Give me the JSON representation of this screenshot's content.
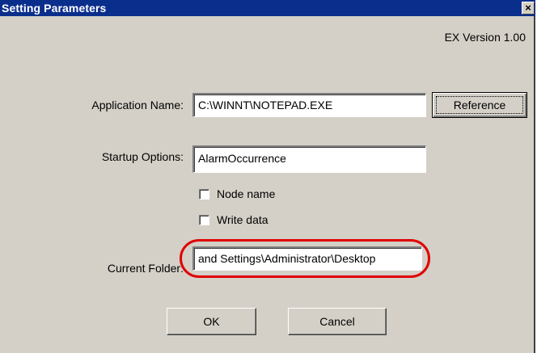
{
  "window": {
    "title": "Setting Parameters",
    "close_glyph": "×",
    "version": "EX Version 1.00"
  },
  "form": {
    "application_name": {
      "label": "Application Name:",
      "value": "C:\\WINNT\\NOTEPAD.EXE"
    },
    "reference_button": "Reference",
    "startup_options": {
      "label": "Startup Options:",
      "value": "AlarmOccurrence"
    },
    "checkboxes": [
      {
        "label": "Node name",
        "checked": false
      },
      {
        "label": "Write data",
        "checked": false
      }
    ],
    "current_folder": {
      "label": "Current Folder:",
      "value": "and Settings\\Administrator\\Desktop"
    }
  },
  "buttons": {
    "ok": "OK",
    "cancel": "Cancel"
  },
  "colors": {
    "titlebar": "#0a2e8c",
    "dialog_bg": "#d4d0c8",
    "highlight": "#e00000"
  }
}
